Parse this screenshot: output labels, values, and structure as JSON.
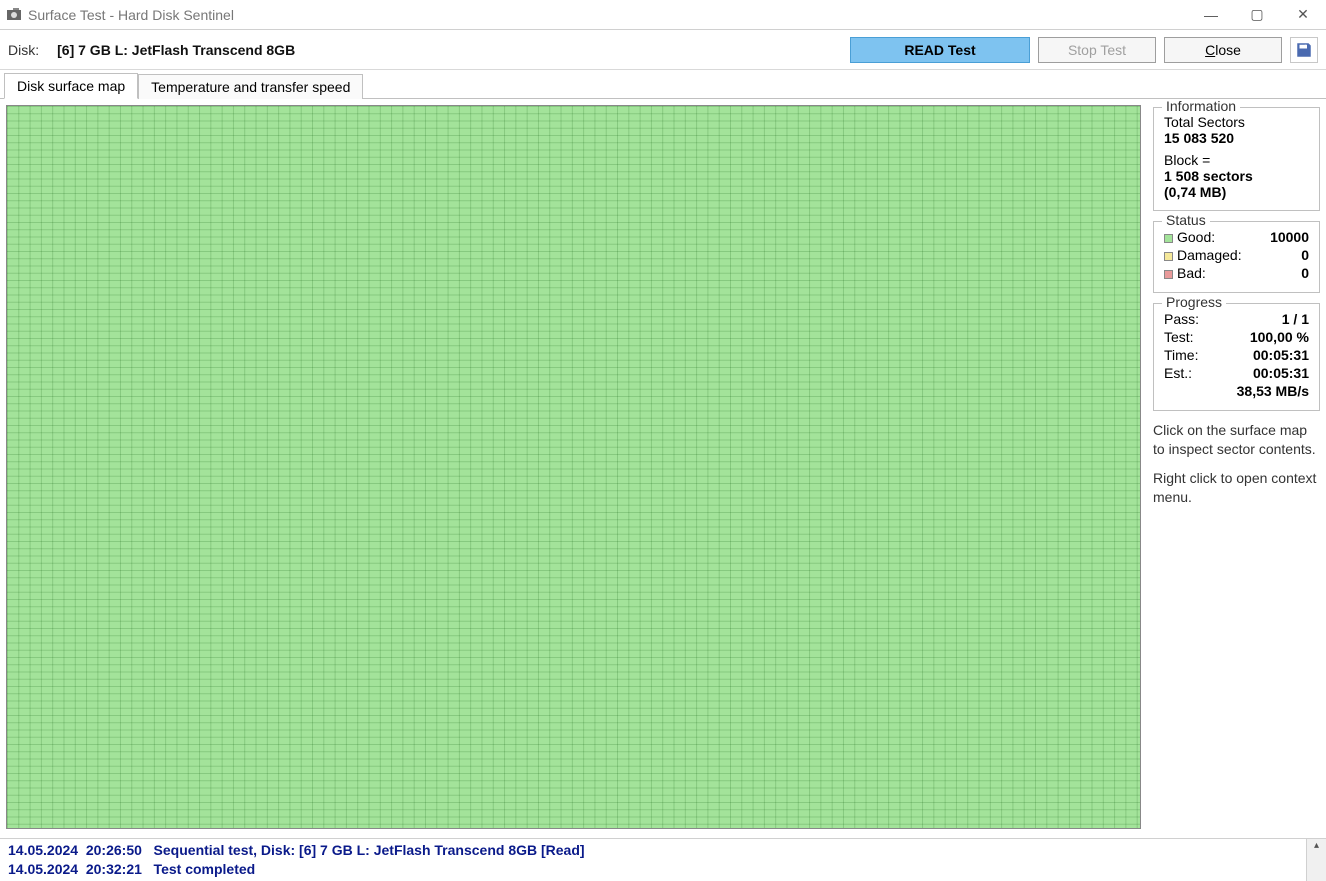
{
  "window": {
    "title": "Surface Test - Hard Disk Sentinel"
  },
  "toolbar": {
    "disk_label": "Disk:",
    "disk_name": "[6] 7 GB L: JetFlash Transcend 8GB",
    "read_btn": "READ Test",
    "stop_btn": "Stop Test",
    "close_btn_pre": "",
    "close_btn_ul": "C",
    "close_btn_post": "lose"
  },
  "tabs": {
    "map": "Disk surface map",
    "temp": "Temperature and transfer speed"
  },
  "info": {
    "legend": "Information",
    "total_sectors_label": "Total Sectors",
    "total_sectors_value": "15 083 520",
    "block_label": "Block =",
    "block_sectors": "1 508 sectors",
    "block_size": "(0,74 MB)"
  },
  "status": {
    "legend": "Status",
    "good_label": "Good:",
    "good_value": "10000",
    "damaged_label": "Damaged:",
    "damaged_value": "0",
    "bad_label": "Bad:",
    "bad_value": "0"
  },
  "progress": {
    "legend": "Progress",
    "pass_label": "Pass:",
    "pass_value": "1 / 1",
    "test_label": "Test:",
    "test_value": "100,00 %",
    "time_label": "Time:",
    "time_value": "00:05:31",
    "est_label": "Est.:",
    "est_value": "00:05:31",
    "speed_value": "38,53 MB/s"
  },
  "hints": {
    "click": "Click on the surface map to inspect sector contents.",
    "rclick": "Right click to open context menu."
  },
  "log": {
    "l1": "14.05.2024  20:26:50   Sequential test, Disk: [6] 7 GB L: JetFlash Transcend 8GB [Read]",
    "l2": "14.05.2024  20:32:21   Test completed"
  }
}
